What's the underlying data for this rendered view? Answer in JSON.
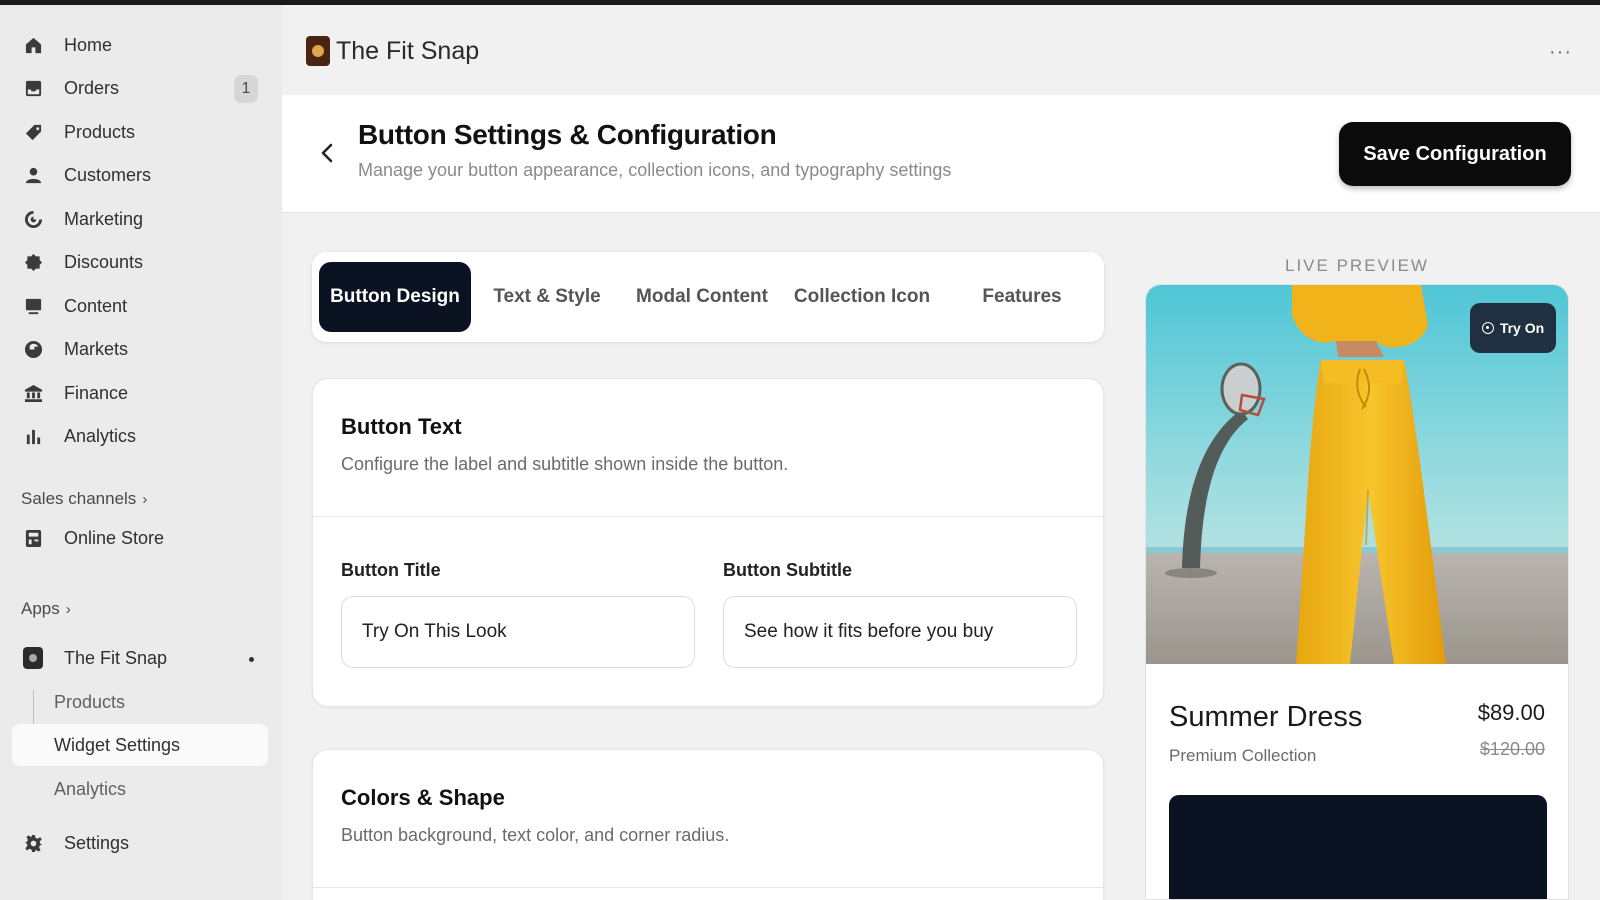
{
  "sidebar": {
    "items": [
      {
        "label": "Home",
        "icon": "home-icon"
      },
      {
        "label": "Orders",
        "icon": "orders-icon",
        "badge": "1"
      },
      {
        "label": "Products",
        "icon": "tag-icon"
      },
      {
        "label": "Customers",
        "icon": "person-icon"
      },
      {
        "label": "Marketing",
        "icon": "target-icon"
      },
      {
        "label": "Discounts",
        "icon": "discount-icon"
      },
      {
        "label": "Content",
        "icon": "content-icon"
      },
      {
        "label": "Markets",
        "icon": "globe-icon"
      },
      {
        "label": "Finance",
        "icon": "bank-icon"
      },
      {
        "label": "Analytics",
        "icon": "bar-chart-icon"
      }
    ],
    "sales_channels_label": "Sales channels",
    "online_store_label": "Online Store",
    "apps_label": "Apps",
    "app_name": "The Fit Snap",
    "app_sub_items": [
      {
        "label": "Products"
      },
      {
        "label": "Widget Settings"
      },
      {
        "label": "Analytics"
      }
    ],
    "settings_label": "Settings"
  },
  "topbar": {
    "app_title": "The Fit Snap",
    "more_label": "···"
  },
  "page_header": {
    "title": "Button Settings & Configuration",
    "subtitle": "Manage your button appearance, collection icons, and typography settings",
    "save_label": "Save Configuration"
  },
  "tabs": [
    {
      "label": "Button Design",
      "active": true
    },
    {
      "label": "Text & Style"
    },
    {
      "label": "Modal Content"
    },
    {
      "label": "Collection Icon"
    },
    {
      "label": "Features"
    }
  ],
  "button_text_card": {
    "title": "Button Text",
    "description": "Configure the label and subtitle shown inside the button.",
    "title_field_label": "Button Title",
    "title_field_value": "Try On This Look",
    "subtitle_field_label": "Button Subtitle",
    "subtitle_field_value": "See how it fits before you buy"
  },
  "colors_card": {
    "title": "Colors & Shape",
    "description": "Button background, text color, and corner radius."
  },
  "preview": {
    "label": "LIVE PREVIEW",
    "try_on_label": "Try On",
    "product_name": "Summer Dress",
    "collection": "Premium Collection",
    "price": "$89.00",
    "compare_price": "$120.00"
  },
  "colors": {
    "accent_dark": "#0b1221",
    "save_button": "#0b0b0b",
    "try_on_button": "#1f3140"
  }
}
